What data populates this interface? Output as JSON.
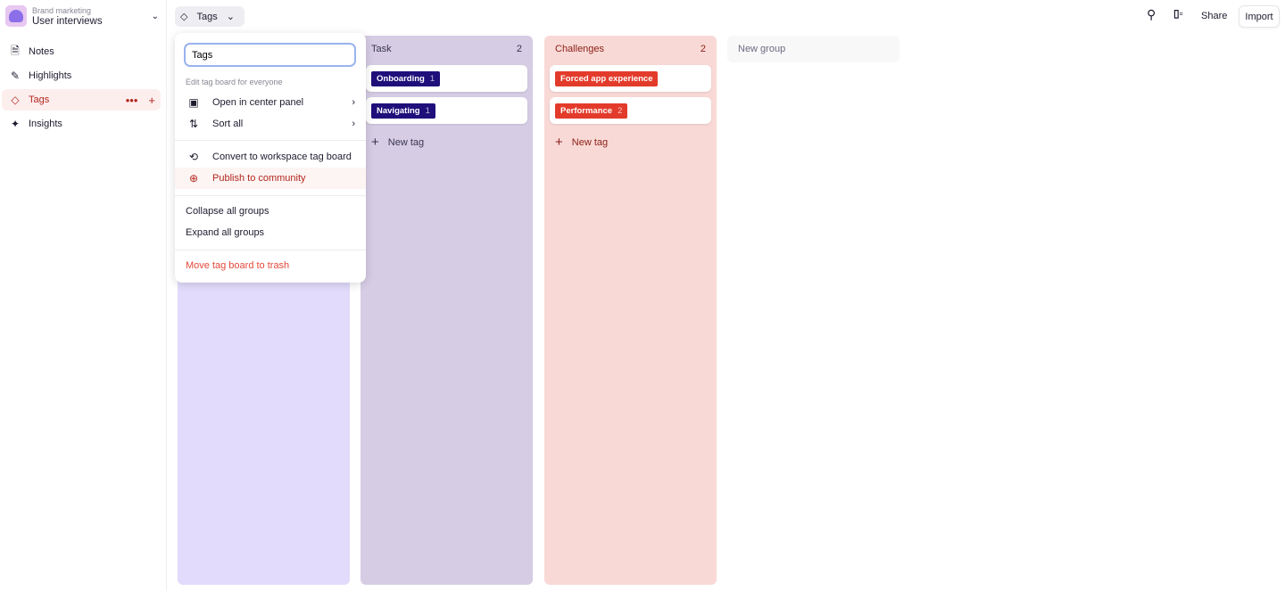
{
  "sidebar": {
    "workspace": "Brand marketing",
    "project": "User interviews",
    "items": [
      {
        "label": "Notes",
        "icon": "note-icon"
      },
      {
        "label": "Highlights",
        "icon": "pen-icon"
      },
      {
        "label": "Tags",
        "icon": "tag-icon",
        "active": true
      },
      {
        "label": "Insights",
        "icon": "sparkle-icon"
      }
    ]
  },
  "header": {
    "board_label": "Tags",
    "share": "Share",
    "import": "Import"
  },
  "menu": {
    "input_value": "Tags",
    "section": "Edit tag board for everyone",
    "open_center": "Open in center panel",
    "sort_all": "Sort all",
    "convert": "Convert to workspace tag board",
    "publish": "Publish to community",
    "collapse": "Collapse all groups",
    "expand": "Expand all groups",
    "trash": "Move tag board to trash"
  },
  "columns": [
    {
      "title": "",
      "count": "",
      "color": "#e2dbfb",
      "tags": []
    },
    {
      "title": "Task",
      "count": "2",
      "color": "#d6cce4",
      "tag_color": "#1f0f7a",
      "tags": [
        {
          "name": "Onboarding",
          "count": "1"
        },
        {
          "name": "Navigating",
          "count": "1"
        }
      ],
      "new_tag": "New tag"
    },
    {
      "title": "Challenges",
      "count": "2",
      "color": "#f8d9d6",
      "tag_color": "#e33b2b",
      "tags": [
        {
          "name": "Forced app experience",
          "count": ""
        },
        {
          "name": "Performance",
          "count": "2"
        }
      ],
      "new_tag": "New tag"
    }
  ],
  "new_group": "New group"
}
